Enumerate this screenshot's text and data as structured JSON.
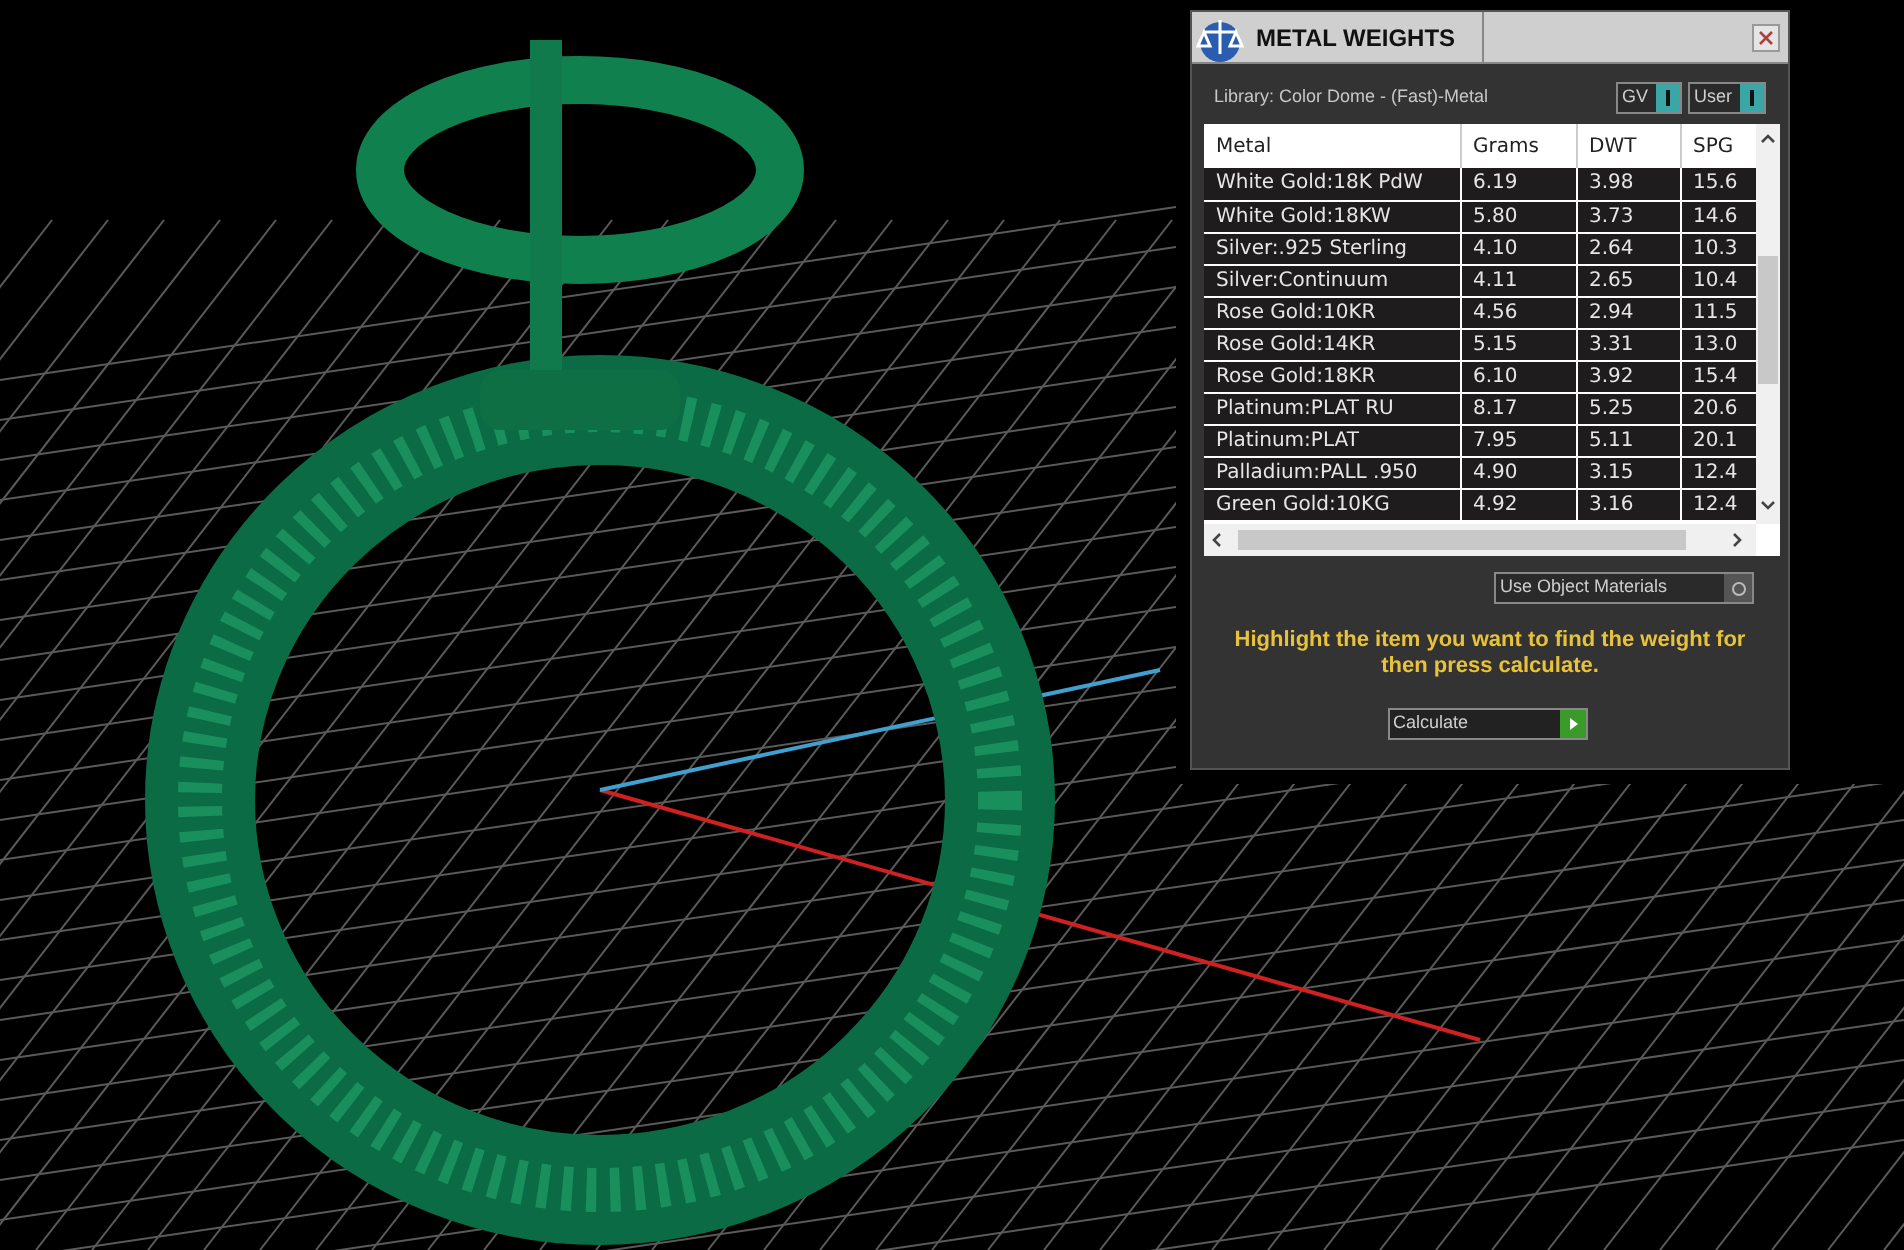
{
  "panel": {
    "title": "METAL WEIGHTS",
    "library": "Library: Color Dome - (Fast)-Metal",
    "toggles": [
      {
        "label": "GV",
        "on": true
      },
      {
        "label": "User",
        "on": true
      }
    ],
    "table": {
      "columns": [
        "Metal",
        "Grams",
        "DWT",
        "SPG"
      ],
      "rows": [
        [
          "White Gold:18K PdW",
          "6.19",
          "3.98",
          "15.6"
        ],
        [
          "White Gold:18KW",
          "5.80",
          "3.73",
          "14.6"
        ],
        [
          "Silver:.925 Sterling",
          "4.10",
          "2.64",
          "10.3"
        ],
        [
          "Silver:Continuum",
          "4.11",
          "2.65",
          "10.4"
        ],
        [
          "Rose Gold:10KR",
          "4.56",
          "2.94",
          "11.5"
        ],
        [
          "Rose Gold:14KR",
          "5.15",
          "3.31",
          "13.0"
        ],
        [
          "Rose Gold:18KR",
          "6.10",
          "3.92",
          "15.4"
        ],
        [
          "Platinum:PLAT RU",
          "8.17",
          "5.25",
          "20.6"
        ],
        [
          "Platinum:PLAT",
          "7.95",
          "5.11",
          "20.1"
        ],
        [
          "Palladium:PALL .950",
          "4.90",
          "3.15",
          "12.4"
        ],
        [
          "Green Gold:10KG",
          "4.92",
          "3.16",
          "12.4"
        ]
      ]
    },
    "use_object_materials": {
      "label": "Use Object Materials",
      "on": false
    },
    "hint": "Highlight the item you want to find the weight for then press calculate.",
    "calculate_button": "Calculate"
  }
}
